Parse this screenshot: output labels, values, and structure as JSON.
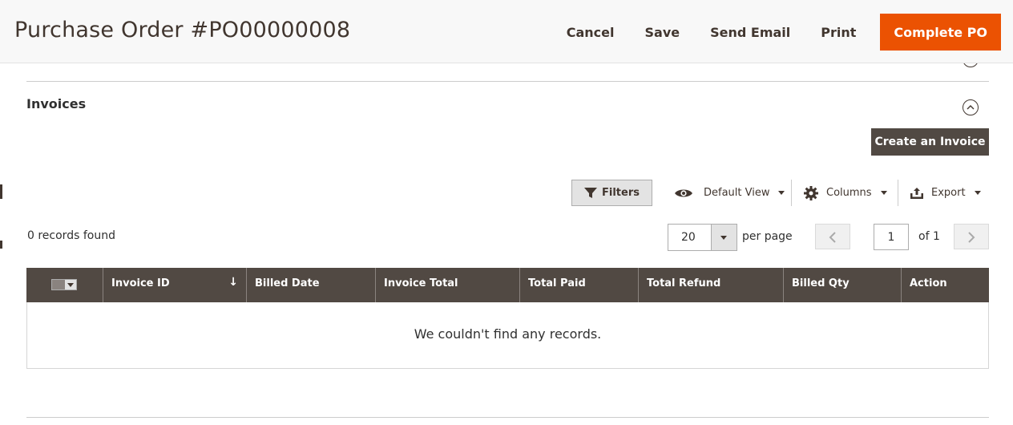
{
  "header": {
    "title": "Purchase Order #PO00000008",
    "actions": {
      "cancel": "Cancel",
      "save": "Save",
      "send_email": "Send Email",
      "print": "Print",
      "complete": "Complete PO"
    }
  },
  "section": {
    "title": "Invoices",
    "create_button": "Create an Invoice"
  },
  "toolbar": {
    "filters": "Filters",
    "view": "Default View",
    "columns": "Columns",
    "export": "Export"
  },
  "pager": {
    "records_found": "0 records found",
    "per_page_value": "20",
    "per_page_label": "per page",
    "current_page": "1",
    "of_pages": "of 1"
  },
  "grid": {
    "columns": [
      "Invoice ID",
      "Billed Date",
      "Invoice Total",
      "Total Paid",
      "Total Refund",
      "Billed Qty",
      "Action"
    ],
    "sort_indicator": "↓",
    "empty_message": "We couldn't find any records."
  },
  "colors": {
    "accent": "#eb5202",
    "header_dark": "#514943"
  }
}
